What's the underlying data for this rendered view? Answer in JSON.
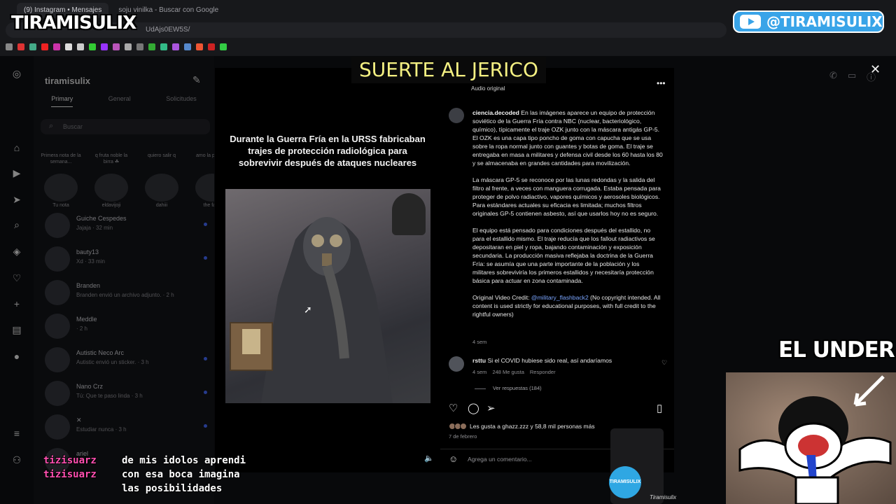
{
  "browser": {
    "tabs": [
      "(9) Instagram • Mensajes",
      "soju vinilka - Buscar con Google"
    ],
    "address": "UdAjs0EW5S/"
  },
  "overlay": {
    "logo": "TIRAMISULIX",
    "youtube_handle": "@TIRAMISULIX",
    "song_title": "SUERTE AL JERICO",
    "webcam_label": "EL UNDER",
    "mug_logo": "TIRAMISULIX",
    "signature": "Tiramisulix"
  },
  "dm_panel": {
    "username": "tiramisulix",
    "tabs": [
      "Primary",
      "General",
      "Solicitudes"
    ],
    "search_placeholder": "Buscar",
    "notes": [
      {
        "bubble": "Primera nota de la semana...",
        "name": "Tu nota"
      },
      {
        "bubble": "q fruta noble la birra ☘",
        "name": "eldavijoji"
      },
      {
        "bubble": "quiero salir q",
        "name": "dahiii"
      },
      {
        "bubble": "amo la paloma",
        "name": "the fake"
      }
    ],
    "conversations": [
      {
        "name": "Guiche Cespedes",
        "preview": "Jajaja · 32 min"
      },
      {
        "name": "bauty13",
        "preview": "Xd · 33 min"
      },
      {
        "name": "Branden",
        "preview": "Branden envió un archivo adjunto. · 2 h"
      },
      {
        "name": "Meddle",
        "preview": "· 2 h"
      },
      {
        "name": "Autistic Neco Arc",
        "preview": "Autistic envió un sticker. · 3 h"
      },
      {
        "name": "Nano Crz",
        "preview": "Tú: Que te paso linda · 3 h"
      },
      {
        "name": "✕",
        "preview": "Estudiar nunca · 3 h"
      },
      {
        "name": "ariel",
        "preview": ""
      }
    ]
  },
  "post": {
    "media_caption": "Durante la Guerra Fría en la URSS fabricaban trajes de protección radiológica para sobrevivir después de ataques nucleares",
    "audio": "Audio original",
    "author": "ciencia.decoded",
    "caption_paragraphs": [
      "En las imágenes aparece un equipo de protección soviético de la Guerra Fría contra NBC (nuclear, bacteriológico, químico), típicamente el traje OZK junto con la máscara antigás GP-5. El OZK es una capa tipo poncho de goma con capucha que se usa sobre la ropa normal junto con guantes y botas de goma. El traje se entregaba en masa a militares y defensa civil desde los 60 hasta los 80 y se almacenaba en grandes cantidades para movilización.",
      "La máscara GP-5 se reconoce por las lunas redondas y la salida del filtro al frente, a veces con manguera corrugada. Estaba pensada para proteger de polvo radiactivo, vapores químicos y aerosoles biológicos. Para estándares actuales su eficacia es limitada; muchos filtros originales GP-5 contienen asbesto, así que usarlos hoy no es seguro.",
      "El equipo está pensado para condiciones después del estallido, no para el estallido mismo. El traje reducía que los fallout radiactivos se depositaran en piel y ropa, bajando contaminación y exposición secundaria. La producción masiva reflejaba la doctrina de la Guerra Fría: se asumía que una parte importante de la población y los militares sobreviviría los primeros estallidos y necesitaría protección básica para actuar en zona contaminada."
    ],
    "credit_prefix": "Original Video Credit: ",
    "credit_handle": "@military_flashback2",
    "credit_suffix": " (No copyright intended. All content is used strictly for educational purposes, with full credit to the rightful owners)",
    "caption_time": "4 sem",
    "comment": {
      "user": "rsttu",
      "text": "Si el COVID hubiese sido real, así andaríamos",
      "time": "4 sem",
      "likes": "248 Me gusta",
      "reply": "Responder",
      "replies": "Ver respuestas (184)"
    },
    "likes_text": "Les gusta a ghazz.zzz y 58,8 mil personas más",
    "date": "7 de febrero",
    "comment_placeholder": "Agrega un comentario..."
  },
  "stream_chat": [
    {
      "user": "tizisuarz",
      "message": "de mis idolos aprendi"
    },
    {
      "user": "tizisuarz",
      "message": "con esa boca imagina"
    }
  ],
  "stream_chat_continuation": "las posibilidades",
  "colors": {
    "chat_user": "#ff4fb0",
    "song_title": "#f4f082",
    "youtube_badge": "#39a4e8"
  }
}
